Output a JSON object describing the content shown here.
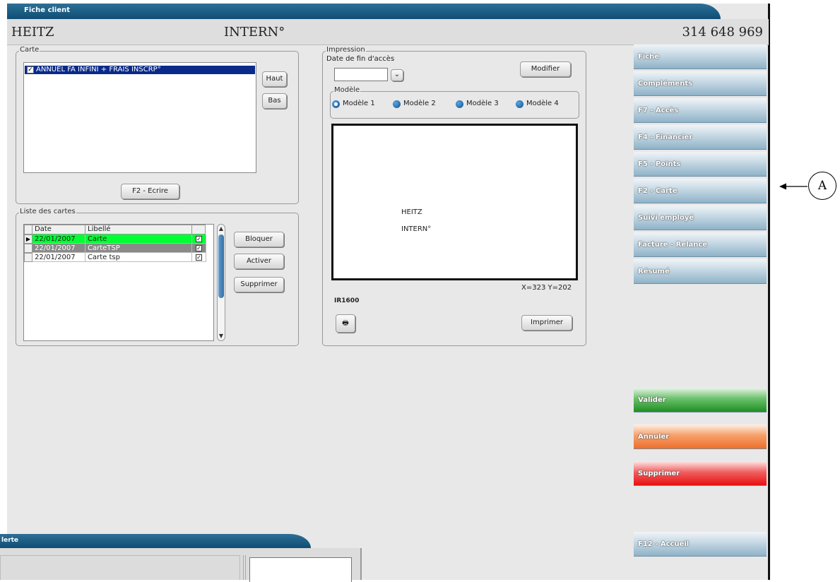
{
  "window": {
    "title": "Fiche client",
    "client_name": "HEITZ",
    "client_status": "INTERN°",
    "client_phone": "314 648 969"
  },
  "carte": {
    "legend": "Carte",
    "items": [
      {
        "label": "ANNUEL FA INFINI + FRAIS INSCRP°",
        "checked": true
      }
    ],
    "btn_haut": "Haut",
    "btn_bas": "Bas",
    "btn_ecrire": "F2 - Ecrire"
  },
  "liste_cartes": {
    "legend": "Liste des cartes",
    "columns": [
      "Date",
      "Libellé"
    ],
    "rows": [
      {
        "date": "22/01/2007",
        "libelle": "Carte",
        "checked": true,
        "current": true,
        "bg": "#00ff33"
      },
      {
        "date": "22/01/2007",
        "libelle": "CarteTSP",
        "checked": true,
        "current": false,
        "bg": "#8a8a8a"
      },
      {
        "date": "22/01/2007",
        "libelle": "Carte tsp",
        "checked": true,
        "current": false,
        "bg": "#ffffff"
      }
    ],
    "btn_bloquer": "Bloquer",
    "btn_activer": "Activer",
    "btn_supprimer": "Supprimer"
  },
  "impression": {
    "legend": "Impression",
    "date_label": "Date de fin d'accès",
    "date_value": "",
    "btn_modifier": "Modifier",
    "modele_legend": "Modèle",
    "modeles": [
      "Modèle 1",
      "Modèle 2",
      "Modèle 3",
      "Modèle 4"
    ],
    "selected_modele": "Modèle 1",
    "preview_name": "HEITZ",
    "preview_status": "INTERN°",
    "coords": "X=323 Y=202",
    "printer": "IR1600",
    "btn_imprimer": "Imprimer"
  },
  "sidebar": {
    "items": [
      {
        "label": "Fiche"
      },
      {
        "label": "Compléments"
      },
      {
        "label": "F7 - Accès"
      },
      {
        "label": "F4 - Financier"
      },
      {
        "label": "F5 - Points"
      },
      {
        "label": "F2 - Carte"
      },
      {
        "label": "Suivi employé"
      },
      {
        "label": "Facture - Relance"
      },
      {
        "label": "Résumé"
      }
    ],
    "valider": "Valider",
    "annuler": "Annuler",
    "supprimer": "Supprimer",
    "accueil": "F12 - Accueil",
    "colors": {
      "blue": "#8fb2c8",
      "green": "#1f8f23",
      "orange": "#ee6e2a",
      "red": "#e81010"
    }
  },
  "annotation": {
    "label": "A"
  },
  "alert_window": {
    "title": "lerte"
  }
}
